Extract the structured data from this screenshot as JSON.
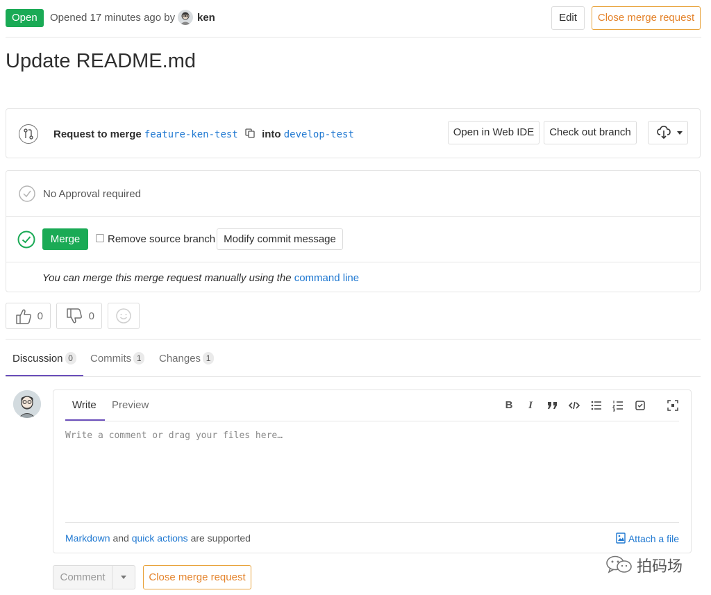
{
  "header": {
    "status": "Open",
    "opened_text": "Opened 17 minutes ago by",
    "author": "ken",
    "edit_label": "Edit",
    "close_label": "Close merge request"
  },
  "title": "Update README.md",
  "branch": {
    "request_text": "Request to merge",
    "source": "feature-ken-test",
    "into_text": "into",
    "target": "develop-test",
    "open_ide_label": "Open in Web IDE",
    "checkout_label": "Check out branch"
  },
  "widget": {
    "approval": "No Approval required",
    "merge_label": "Merge",
    "remove_source": "Remove source branch",
    "modify_commit": "Modify commit message",
    "manual_text": "You can merge this merge request manually using the",
    "command_line": "command line"
  },
  "awards": {
    "thumbs_up": "0",
    "thumbs_down": "0"
  },
  "tabs": [
    {
      "label": "Discussion",
      "count": "0"
    },
    {
      "label": "Commits",
      "count": "1"
    },
    {
      "label": "Changes",
      "count": "1"
    }
  ],
  "editor": {
    "write": "Write",
    "preview": "Preview",
    "placeholder": "Write a comment or drag your files here…",
    "markdown": "Markdown",
    "and": "and",
    "quick_actions": "quick actions",
    "supported": "are supported",
    "attach": "Attach a file"
  },
  "footer": {
    "comment": "Comment",
    "close_label": "Close merge request"
  },
  "watermark": {
    "text": "拍码场"
  },
  "colors": {
    "success": "#1aaa55",
    "link": "#1f78d1",
    "warning": "#e4832b",
    "tab_active": "#6b4fbb"
  }
}
